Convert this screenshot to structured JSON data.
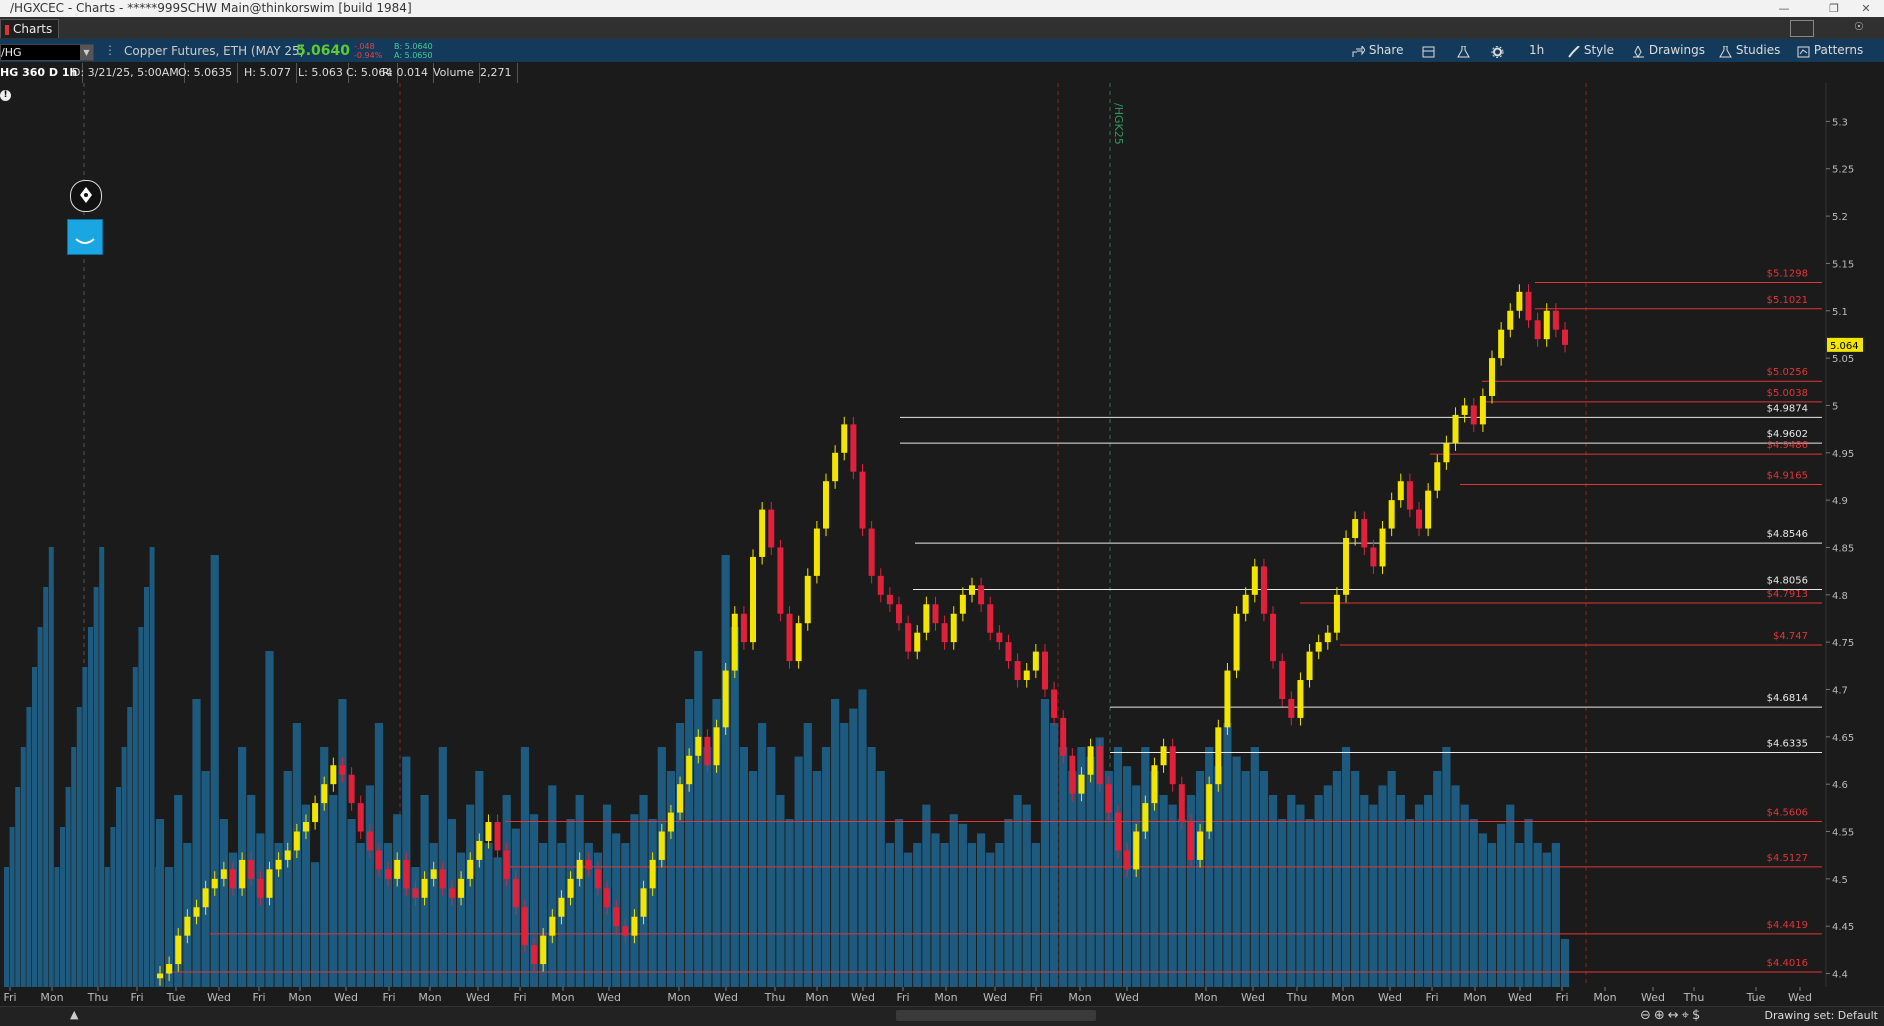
{
  "window": {
    "title": "/HGXCEC - Charts - *****999SCHW Main@thinkorswim [build 1984]"
  },
  "tab": {
    "label": "Charts"
  },
  "symbol": {
    "value": "/HG",
    "description": "Copper Futures, ETH (MAY 25)",
    "last": "5.0640",
    "change": "-.048",
    "change_pct": "-0.94%",
    "bid": "B: 5.0640",
    "ask": "A: 5.0650"
  },
  "toolbar": {
    "share": "Share",
    "timeframe": "1h",
    "style": "Style",
    "drawings": "Drawings",
    "studies": "Studies",
    "patterns": "Patterns"
  },
  "info": {
    "aggregation": "HG 360 D 1h",
    "date": "D: 3/21/25, 5:00AM",
    "open": "O: 5.0635",
    "high": "H: 5.077",
    "low": "L: 5.063",
    "close": "C: 5.064",
    "range": "R: 0.014",
    "volume_label": "Volume",
    "volume_value": "2,271"
  },
  "colors": {
    "up": "#f2e600",
    "down": "#e0213c",
    "volume": "#1d5a7d",
    "red_level": "#e0353a",
    "white_level": "#e8e8e8",
    "last_price_badge": "#f2e600"
  },
  "chart_data": {
    "type": "candlestick",
    "y_axis": {
      "range": [
        4.39,
        5.33
      ],
      "ticks": [
        "5.3",
        "5.25",
        "5.2",
        "5.15",
        "5.1",
        "5.05",
        "5",
        "4.95",
        "4.9",
        "4.85",
        "4.8",
        "4.75",
        "4.7",
        "4.65",
        "4.6",
        "4.55",
        "4.5",
        "4.45",
        "4.4"
      ]
    },
    "x_axis_labels": [
      "Fri",
      "Mon",
      "Thu",
      "Fri",
      "Tue",
      "Wed",
      "Fri",
      "Mon",
      "Wed",
      "Fri",
      "Mon",
      "Wed",
      "Fri",
      "Mon",
      "Wed",
      "Mon",
      "Wed",
      "Thu",
      "Mon",
      "Wed",
      "Fri",
      "Mon",
      "Wed",
      "Fri",
      "Mon",
      "Wed",
      "Mon",
      "Wed",
      "Thu",
      "Mon",
      "Wed",
      "Fri",
      "Mon",
      "Wed",
      "Fri",
      "Mon",
      "Wed",
      "Thu",
      "Tue",
      "Wed"
    ],
    "last_price_badge": "5.064",
    "expiration_marker": "/HGK25",
    "levels": [
      {
        "price": 5.1298,
        "label": "$5.1298",
        "color": "red"
      },
      {
        "price": 5.1021,
        "label": "$5.1021",
        "color": "red"
      },
      {
        "price": 5.0256,
        "label": "$5.0256",
        "color": "red"
      },
      {
        "price": 5.0038,
        "label": "$5.0038",
        "color": "red"
      },
      {
        "price": 4.9874,
        "label": "$4.9874",
        "color": "white"
      },
      {
        "price": 4.9602,
        "label": "$4.9602",
        "color": "white"
      },
      {
        "price": 4.9486,
        "label": "$4.9486",
        "color": "red"
      },
      {
        "price": 4.9165,
        "label": "$4.9165",
        "color": "red"
      },
      {
        "price": 4.8546,
        "label": "$4.8546",
        "color": "white"
      },
      {
        "price": 4.8056,
        "label": "$4.8056",
        "color": "white"
      },
      {
        "price": 4.7913,
        "label": "$4.7913",
        "color": "red"
      },
      {
        "price": 4.747,
        "label": "$4.747",
        "color": "red"
      },
      {
        "price": 4.6814,
        "label": "$4.6814",
        "color": "white"
      },
      {
        "price": 4.6335,
        "label": "$4.6335",
        "color": "white"
      },
      {
        "price": 4.5606,
        "label": "$4.5606",
        "color": "red"
      },
      {
        "price": 4.5127,
        "label": "$4.5127",
        "color": "red"
      },
      {
        "price": 4.4419,
        "label": "$4.4419",
        "color": "red"
      },
      {
        "price": 4.4016,
        "label": "$4.4016",
        "color": "red"
      }
    ],
    "price_path": [
      4.4,
      4.41,
      4.44,
      4.46,
      4.47,
      4.49,
      4.5,
      4.51,
      4.49,
      4.52,
      4.5,
      4.48,
      4.51,
      4.52,
      4.53,
      4.55,
      4.56,
      4.58,
      4.6,
      4.62,
      4.61,
      4.58,
      4.55,
      4.53,
      4.51,
      4.5,
      4.52,
      4.49,
      4.48,
      4.5,
      4.51,
      4.49,
      4.48,
      4.5,
      4.52,
      4.54,
      4.56,
      4.53,
      4.5,
      4.47,
      4.43,
      4.41,
      4.44,
      4.46,
      4.48,
      4.5,
      4.52,
      4.51,
      4.49,
      4.47,
      4.45,
      4.44,
      4.46,
      4.49,
      4.52,
      4.55,
      4.57,
      4.6,
      4.63,
      4.65,
      4.62,
      4.66,
      4.72,
      4.78,
      4.75,
      4.84,
      4.89,
      4.85,
      4.78,
      4.73,
      4.77,
      4.82,
      4.87,
      4.92,
      4.95,
      4.98,
      4.93,
      4.87,
      4.82,
      4.8,
      4.79,
      4.77,
      4.74,
      4.76,
      4.79,
      4.77,
      4.75,
      4.78,
      4.8,
      4.81,
      4.79,
      4.76,
      4.75,
      4.73,
      4.71,
      4.72,
      4.74,
      4.7,
      4.67,
      4.63,
      4.59,
      4.61,
      4.64,
      4.6,
      4.57,
      4.53,
      4.51,
      4.55,
      4.58,
      4.62,
      4.64,
      4.6,
      4.56,
      4.52,
      4.55,
      4.6,
      4.66,
      4.72,
      4.78,
      4.8,
      4.83,
      4.78,
      4.73,
      4.69,
      4.67,
      4.71,
      4.74,
      4.75,
      4.76,
      4.8,
      4.86,
      4.88,
      4.85,
      4.83,
      4.87,
      4.9,
      4.92,
      4.89,
      4.87,
      4.91,
      4.94,
      4.96,
      4.99,
      5.0,
      4.98,
      5.01,
      5.05,
      5.08,
      5.1,
      5.12,
      5.09,
      5.07,
      5.1,
      5.08,
      5.064
    ],
    "volume_scale": [
      0.35,
      0.25,
      0.4,
      0.3,
      0.6,
      0.45,
      0.9,
      0.35,
      0.28,
      0.5,
      0.4,
      0.32,
      0.7,
      0.3,
      0.45,
      0.55,
      0.38,
      0.26,
      0.5,
      0.4,
      0.6,
      0.35,
      0.3,
      0.42,
      0.55,
      0.3,
      0.36,
      0.48,
      0.25,
      0.4,
      0.3,
      0.5,
      0.35,
      0.28,
      0.38,
      0.45,
      0.3,
      0.27,
      0.4,
      0.33,
      0.5,
      0.36,
      0.3,
      0.42,
      0.3,
      0.35,
      0.4,
      0.3,
      0.28,
      0.38,
      0.32,
      0.3,
      0.36,
      0.4,
      0.35,
      0.5,
      0.45,
      0.55,
      0.6,
      0.7,
      0.5,
      0.6,
      0.9,
      0.75,
      0.5,
      0.45,
      0.55,
      0.5,
      0.4,
      0.35,
      0.48,
      0.55,
      0.45,
      0.5,
      0.6,
      0.55,
      0.58,
      0.62,
      0.5,
      0.45,
      0.3,
      0.35,
      0.28,
      0.3,
      0.38,
      0.32,
      0.3,
      0.36,
      0.34,
      0.3,
      0.32,
      0.28,
      0.3,
      0.35,
      0.4,
      0.38,
      0.3,
      0.6,
      0.55,
      0.5,
      0.45,
      0.5,
      0.48,
      0.52,
      0.45,
      0.5,
      0.46,
      0.42,
      0.5,
      0.45,
      0.4,
      0.38,
      0.35,
      0.4,
      0.45,
      0.5,
      0.46,
      0.55,
      0.48,
      0.45,
      0.5,
      0.45,
      0.4,
      0.35,
      0.4,
      0.38,
      0.35,
      0.4,
      0.42,
      0.45,
      0.5,
      0.45,
      0.4,
      0.38,
      0.42,
      0.45,
      0.4,
      0.35,
      0.38,
      0.4,
      0.45,
      0.5,
      0.42,
      0.38,
      0.35,
      0.32,
      0.3,
      0.34,
      0.38,
      0.3,
      0.35,
      0.3,
      0.28,
      0.3,
      0.1
    ]
  },
  "bottom": {
    "drawing_set": "Drawing set: Default"
  }
}
